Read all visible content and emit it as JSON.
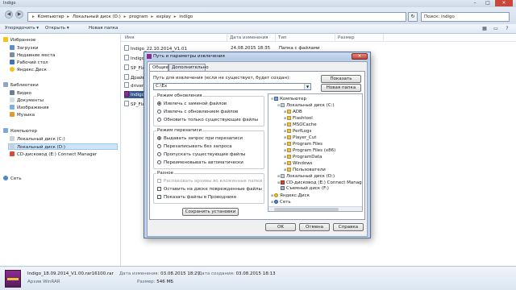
{
  "window": {
    "title": "Indigo",
    "address": {
      "parts": [
        "Компьютер",
        "Локальный диск (D:)",
        "program",
        "explay",
        "indigo"
      ]
    },
    "search_placeholder": "Поиск: indigo"
  },
  "toolbar": {
    "organize": "Упорядочить",
    "open": "Открыть",
    "new_folder": "Новая папка"
  },
  "nav": {
    "favorites": {
      "title": "Избранное",
      "items": [
        "Загрузки",
        "Недавние места",
        "Рабочий стол",
        "Яндекс.Диск"
      ]
    },
    "libraries": {
      "title": "Библиотеки",
      "items": [
        "Видео",
        "Документы",
        "Изображения",
        "Музыка"
      ]
    },
    "computer": {
      "title": "Компьютер",
      "items": [
        "Локальный диск (C:)",
        "Локальный диск (D:)",
        "CD-дисковод (E:) Connect Manager"
      ]
    },
    "network": "Сеть"
  },
  "filelist": {
    "columns": [
      "Имя",
      "Дата изменения",
      "Тип",
      "Размер"
    ],
    "rows": [
      {
        "name": "Indigo_22.10.2014_V1.01",
        "date": "24.08.2015 18:35",
        "type": "Папка с файлами"
      },
      {
        "name": "Indigo"
      },
      {
        "name": "SP_Fla"
      },
      {
        "name": "Драйв"
      },
      {
        "name": "driver"
      },
      {
        "name": "Indigo"
      },
      {
        "name": "SP_Fla"
      }
    ]
  },
  "dialog": {
    "title": "Путь и параметры извлечения",
    "tabs": [
      "Общие",
      "Дополнительно"
    ],
    "path_label": "Путь для извлечения (если не существует, будет создан):",
    "path_value": "C:\\Ex",
    "show_button": "Показать",
    "new_folder_button": "Новая папка",
    "update_mode": {
      "title": "Режим обновления",
      "options": [
        "Извлечь с заменой файлов",
        "Извлечь с обновлением файлов",
        "Обновить только существующие файлы"
      ],
      "selected": 0
    },
    "overwrite_mode": {
      "title": "Режим перезаписи",
      "options": [
        "Выдавать запрос при перезаписи",
        "Перезаписывать без запроса",
        "Пропускать существующие файлы",
        "Переименовывать автоматически"
      ],
      "selected": 0
    },
    "misc": {
      "title": "Разное",
      "options": [
        "Распаковать архивы во вложенные папки",
        "Оставить на диске поврежденные файлы",
        "Показать файлы в Проводнике"
      ]
    },
    "save_settings_button": "Сохранить установки",
    "tree": [
      {
        "label": "Компьютер",
        "icon": "pc",
        "depth": 0,
        "exp": "-"
      },
      {
        "label": "Локальный диск (C:)",
        "icon": "drive",
        "depth": 1,
        "exp": "-"
      },
      {
        "label": "ADB",
        "icon": "folder",
        "depth": 2,
        "exp": "+"
      },
      {
        "label": "Flashtool",
        "icon": "folder",
        "depth": 2,
        "exp": "+"
      },
      {
        "label": "MSOCache",
        "icon": "folder",
        "depth": 2,
        "exp": "+"
      },
      {
        "label": "PerfLogs",
        "icon": "folder",
        "depth": 2,
        "exp": "+"
      },
      {
        "label": "Player_Cut",
        "icon": "folder",
        "depth": 2,
        "exp": "+"
      },
      {
        "label": "Program Files",
        "icon": "folder",
        "depth": 2,
        "exp": "+"
      },
      {
        "label": "Program Files (x86)",
        "icon": "folder",
        "depth": 2,
        "exp": "+"
      },
      {
        "label": "ProgramData",
        "icon": "folder",
        "depth": 2,
        "exp": "+"
      },
      {
        "label": "Windows",
        "icon": "folder",
        "depth": 2,
        "exp": "+"
      },
      {
        "label": "Пользователи",
        "icon": "folder",
        "depth": 2,
        "exp": "+"
      },
      {
        "label": "Локальный диск (D:)",
        "icon": "drive",
        "depth": 1,
        "exp": "+"
      },
      {
        "label": "CD-дисковод (E:) Connect Manag",
        "icon": "cd",
        "depth": 1,
        "exp": "+"
      },
      {
        "label": "Съемный диск (F:)",
        "icon": "disk",
        "depth": 1,
        "exp": ""
      },
      {
        "label": "Яндекс.Диск",
        "icon": "yd",
        "depth": 0,
        "exp": "+"
      },
      {
        "label": "Сеть",
        "icon": "net",
        "depth": 0,
        "exp": "+"
      }
    ],
    "buttons": {
      "ok": "OK",
      "cancel": "Отмена",
      "help": "Справка"
    }
  },
  "status": {
    "filename": "Indigo_18.09.2014_V1.00.rar16100.rar",
    "filetype": "Архив WinRAR",
    "modified_label": "Дата изменения:",
    "modified_value": "03.08.2015 18:29",
    "created_label": "Дата создания:",
    "created_value": "03.08.2015 18:13",
    "size_label": "Размер:",
    "size_value": "546 МБ"
  }
}
